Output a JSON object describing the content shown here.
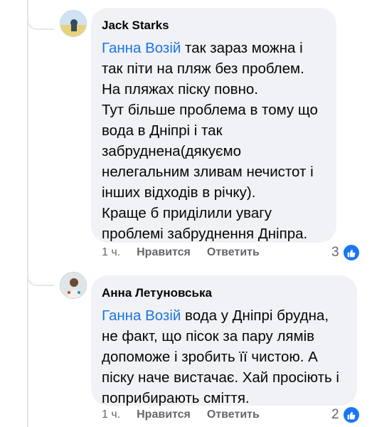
{
  "comments": [
    {
      "author": "Jack Starks",
      "mention": "Ганна Возій",
      "text": " так зараз можна і так піти на пляж без проблем. На пляжах піску повно.\nТут більше проблема в тому що вода в Дніпрі і так забруднена(дякуємо нелегальним зливам нечистот і інших відходів в річку).\nКраще б приділили увагу проблемі забруднення Дніпра.",
      "time": "1 ч.",
      "like_label": "Нравится",
      "reply_label": "Ответить",
      "reaction_count": "3",
      "reaction_icon": "thumbs-up-icon"
    },
    {
      "author": "Анна Летуновська",
      "mention": "Ганна Возій",
      "text": " вода у Дніпрі брудна, не факт, що пісок за пару лямів допоможе і зробить її чистою. А піску наче вистачає. Хай просіють і поприбирають сміття.",
      "time": "1 ч.",
      "like_label": "Нравится",
      "reply_label": "Ответить",
      "reaction_count": "2",
      "reaction_icon": "thumbs-up-icon"
    }
  ],
  "colors": {
    "mention": "#1b74e4",
    "bubble": "#f0f2f5",
    "meta": "#65676b",
    "like_badge": "#1877f2"
  }
}
